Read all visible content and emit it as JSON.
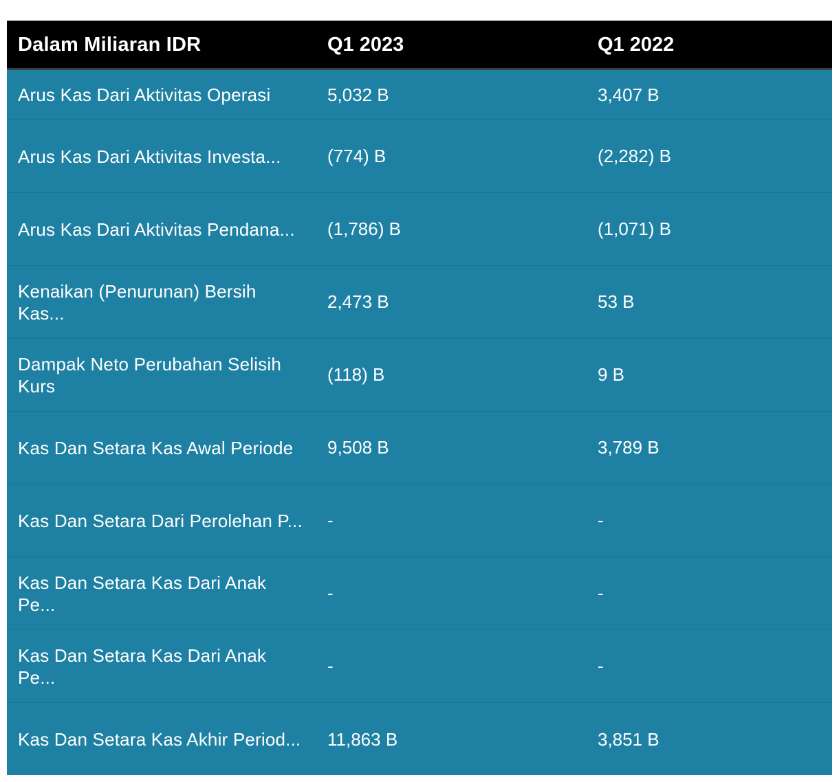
{
  "table": {
    "headers": [
      "Dalam Miliaran IDR",
      "Q1 2023",
      "Q1 2022"
    ],
    "rows": [
      {
        "label": "Arus Kas Dari Aktivitas Operasi",
        "q1_2023": "5,032 B",
        "q1_2022": "3,407 B"
      },
      {
        "label": "Arus Kas Dari Aktivitas Investa...",
        "q1_2023": "(774) B",
        "q1_2022": "(2,282) B"
      },
      {
        "label": "Arus Kas Dari Aktivitas Pendana...",
        "q1_2023": "(1,786) B",
        "q1_2022": "(1,071) B"
      },
      {
        "label": "Kenaikan (Penurunan) Bersih Kas...",
        "q1_2023": "2,473 B",
        "q1_2022": "53 B"
      },
      {
        "label": "Dampak Neto Perubahan Selisih Kurs",
        "q1_2023": "(118) B",
        "q1_2022": "9 B"
      },
      {
        "label": "Kas Dan Setara Kas Awal Periode",
        "q1_2023": "9,508 B",
        "q1_2022": "3,789 B"
      },
      {
        "label": "Kas Dan Setara Dari Perolehan P...",
        "q1_2023": "-",
        "q1_2022": "-"
      },
      {
        "label": "Kas Dan Setara Kas Dari Anak Pe...",
        "q1_2023": "-",
        "q1_2022": "-"
      },
      {
        "label": "Kas Dan Setara Kas Dari Anak Pe...",
        "q1_2023": "-",
        "q1_2022": "-"
      },
      {
        "label": "Kas Dan Setara Kas Akhir Period...",
        "q1_2023": "11,863 B",
        "q1_2022": "3,851 B"
      }
    ]
  },
  "colors": {
    "header_bg": "#000000",
    "row_bg": "#1e81a3",
    "text": "#ffffff"
  }
}
